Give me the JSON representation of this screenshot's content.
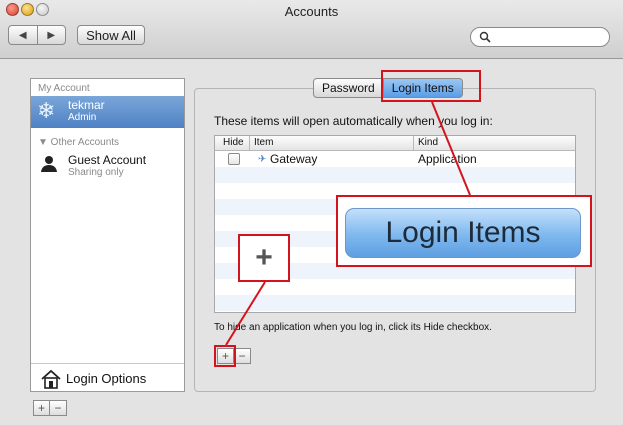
{
  "window": {
    "title": "Accounts"
  },
  "toolbar": {
    "back_glyph": "◀",
    "forward_glyph": "▶",
    "show_all_label": "Show All",
    "search_icon": "search-icon",
    "search_placeholder": ""
  },
  "sidebar": {
    "my_account_header": "My Account",
    "selected_user": {
      "name": "tekmar",
      "role": "Admin",
      "icon": "snowflake-user-icon"
    },
    "other_accounts_header": "▼ Other Accounts",
    "guest": {
      "name": "Guest Account",
      "sub": "Sharing only",
      "icon": "person-silhouette-icon"
    },
    "login_options_label": "Login Options",
    "add_glyph": "+",
    "remove_glyph": "−"
  },
  "tabs": {
    "password_label": "Password",
    "login_items_label": "Login Items",
    "active": "Login Items"
  },
  "login_items": {
    "intro": "These items will open automatically when you log in:",
    "columns": [
      "Hide",
      "Item",
      "Kind"
    ],
    "rows": [
      {
        "hide": false,
        "item": "Gateway",
        "kind": "Application"
      }
    ],
    "help": "To hide an application when you log in, click its Hide checkbox.",
    "add_glyph": "+",
    "remove_glyph": "−"
  },
  "callouts": {
    "zoom_tab_label": "Login Items",
    "zoom_add_glyph": "+"
  },
  "colors": {
    "highlight": "#d4141c",
    "selection": "#5a8ccb",
    "tab_active": "#6aaaf0"
  }
}
